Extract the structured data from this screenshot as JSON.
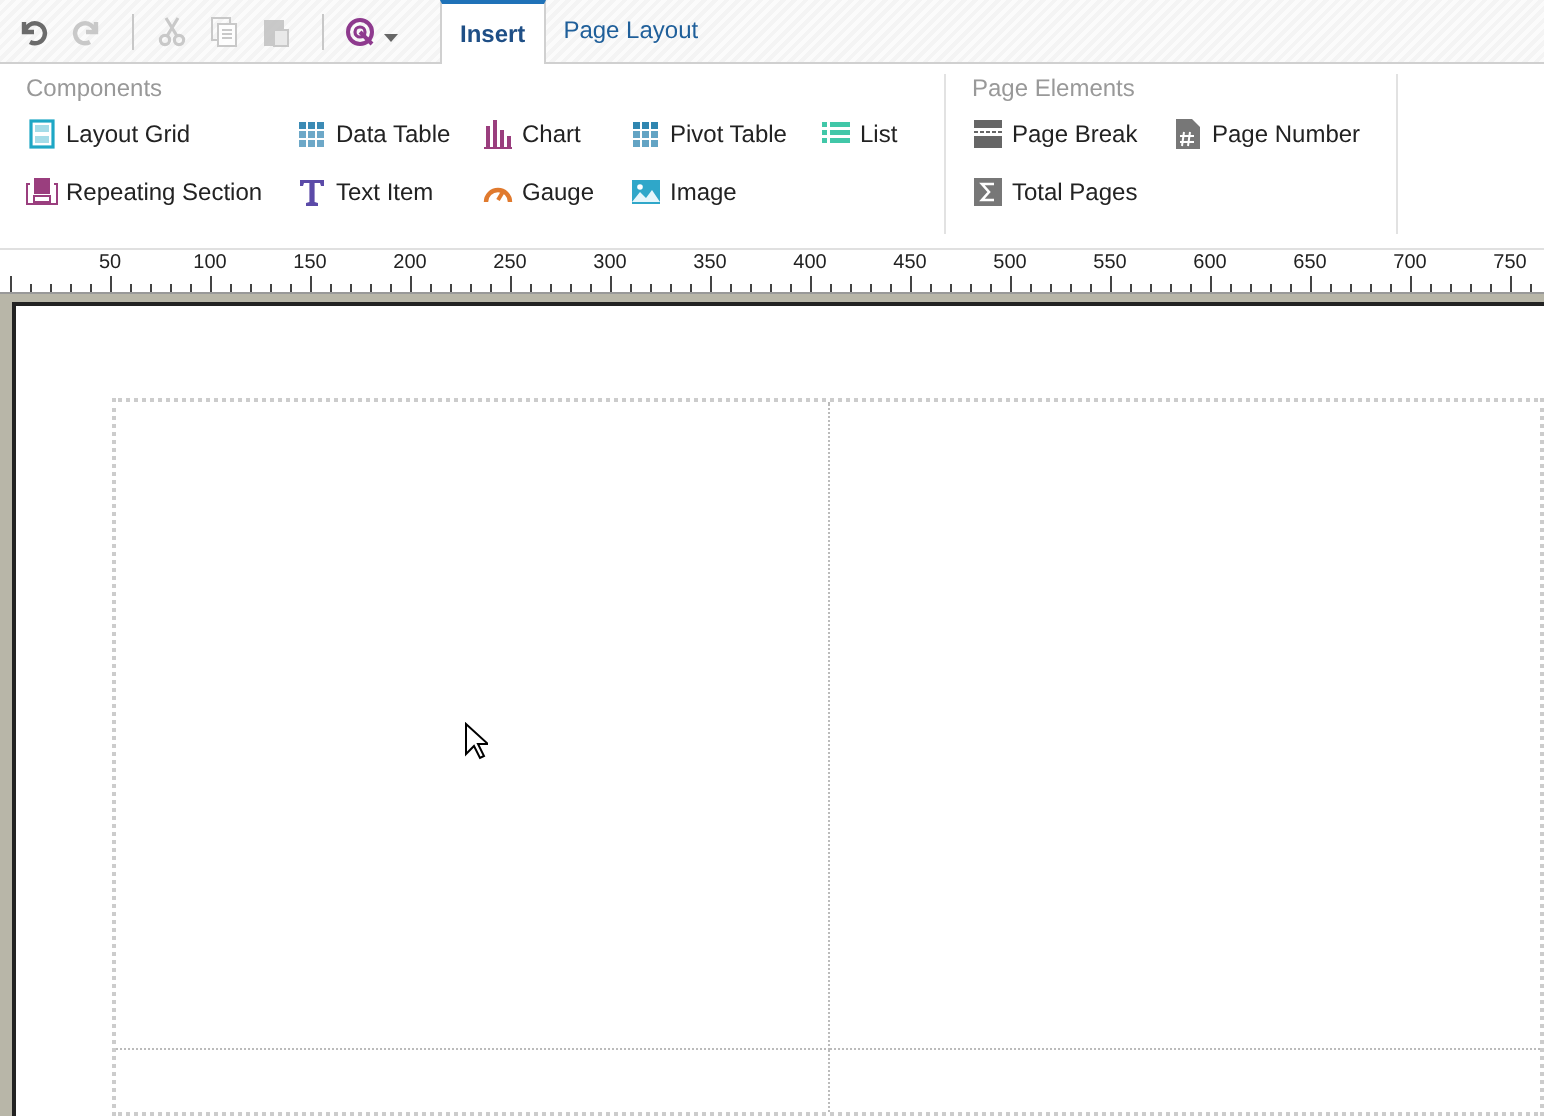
{
  "toolbar": {
    "buttons": [
      {
        "kind": "undo",
        "disabled": false
      },
      {
        "kind": "redo",
        "disabled": true
      },
      {
        "kind": "cut",
        "disabled": true
      },
      {
        "kind": "copy",
        "disabled": true
      },
      {
        "kind": "paste",
        "disabled": true
      },
      {
        "kind": "target",
        "disabled": false
      }
    ]
  },
  "tabs": [
    {
      "label": "Insert",
      "selected": true
    },
    {
      "label": "Page Layout",
      "selected": false
    }
  ],
  "groups": [
    {
      "title": "Components",
      "columns": [
        [
          {
            "label": "Layout Grid",
            "kind": "layout-grid"
          },
          {
            "label": "Repeating Section",
            "kind": "repeating-section"
          }
        ],
        [
          {
            "label": "Data Table",
            "kind": "data-table"
          },
          {
            "label": "Text Item",
            "kind": "text-item"
          }
        ],
        [
          {
            "label": "Chart",
            "kind": "chart"
          },
          {
            "label": "Gauge",
            "kind": "gauge"
          }
        ],
        [
          {
            "label": "Pivot Table",
            "kind": "pivot-table"
          },
          {
            "label": "Image",
            "kind": "image"
          }
        ],
        [
          {
            "label": "List",
            "kind": "list"
          }
        ]
      ]
    },
    {
      "title": "Page Elements",
      "columns": [
        [
          {
            "label": "Page Break",
            "kind": "page-break"
          },
          {
            "label": "Total Pages",
            "kind": "total-pages"
          }
        ],
        [
          {
            "label": "Page Number",
            "kind": "page-number"
          }
        ]
      ]
    }
  ],
  "ruler": [
    "50",
    "100",
    "150",
    "200",
    "250",
    "300",
    "350",
    "400",
    "450",
    "500",
    "550",
    "600",
    "650",
    "700",
    "750"
  ]
}
